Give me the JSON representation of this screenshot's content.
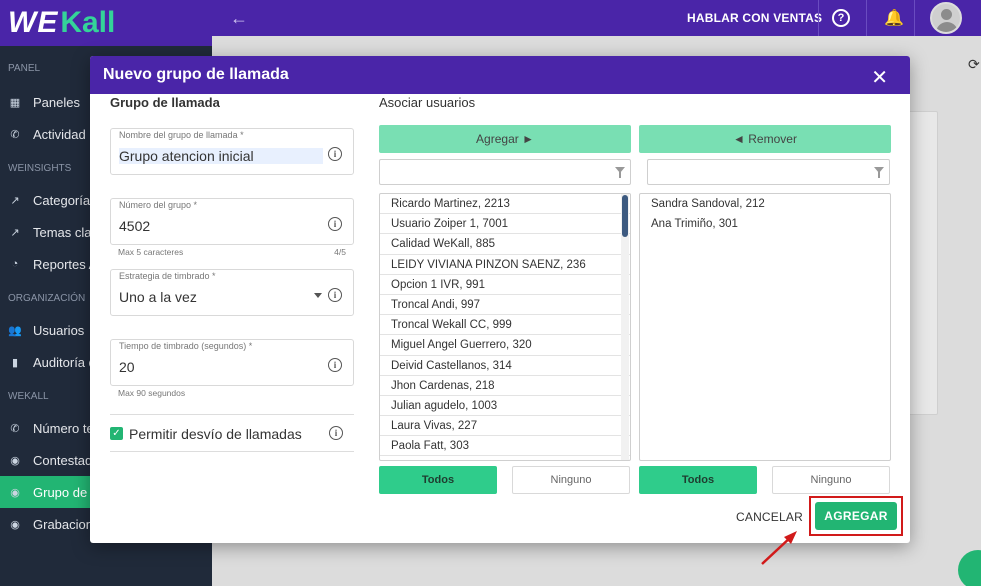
{
  "brand": {
    "we": "WE",
    "kall": "Kall"
  },
  "sidebar": {
    "sections": [
      {
        "title": "PANEL",
        "items": [
          {
            "label": "Paneles",
            "icon": "grid-icon"
          },
          {
            "label": "Actividad E",
            "icon": "phone-icon"
          }
        ]
      },
      {
        "title": "WEINSIGHTS",
        "items": [
          {
            "label": "Categorías",
            "icon": "trend-icon"
          },
          {
            "label": "Temas clav",
            "icon": "trend-icon"
          },
          {
            "label": "Reportes A",
            "icon": "chart-icon"
          }
        ]
      },
      {
        "title": "ORGANIZACIÓN",
        "items": [
          {
            "label": "Usuarios",
            "icon": "users-icon"
          },
          {
            "label": "Auditoría d",
            "icon": "audio-icon"
          }
        ]
      },
      {
        "title": "WEKALL",
        "items": [
          {
            "label": "Número tel",
            "icon": "phone-icon"
          },
          {
            "label": "Contestad",
            "icon": "palette-icon"
          },
          {
            "label": "Grupo de ll",
            "icon": "palette-icon",
            "active": true
          },
          {
            "label": "Grabaciones",
            "icon": "palette-icon"
          }
        ]
      }
    ]
  },
  "topbar": {
    "sales_label": "HABLAR CON VENTAS",
    "help": "?",
    "bell": "🔔"
  },
  "modal": {
    "title": "Nuevo grupo de llamada",
    "close": "✕",
    "left": {
      "section_title": "Grupo de llamada",
      "name_field": {
        "label": "Nombre del grupo de llamada *",
        "value": "Grupo atencion inicial"
      },
      "number_field": {
        "label": "Número del grupo *",
        "value": "4502",
        "hint": "Max 5 caracteres",
        "count": "4/5"
      },
      "strategy_field": {
        "label": "Estrategia de timbrado *",
        "value": "Uno a la vez"
      },
      "time_field": {
        "label": "Tiempo de timbrado (segundos) *",
        "value": "20",
        "hint": "Max 90 segundos"
      },
      "forward_checkbox": {
        "label": "Permitir desvío de llamadas",
        "checked": true
      }
    },
    "right": {
      "title": "Asociar usuarios",
      "add_button": "Agregar  ►",
      "remove_button": "◄   Remover",
      "available_users": [
        "Ricardo Martinez, 2213",
        "Usuario Zoiper 1, 7001",
        "Calidad WeKall, 885",
        "LEIDY VIVIANA PINZON SAENZ, 236",
        "Opcion 1 IVR, 991",
        "Troncal Andi, 997",
        "Troncal Wekall CC, 999",
        "Miguel Angel Guerrero, 320",
        "Deivid Castellanos, 314",
        "Jhon Cardenas, 218",
        "Julian agudelo, 1003",
        "Laura Vivas, 227",
        "Paola Fatt, 303"
      ],
      "selected_users": [
        "Sandra Sandoval, 212",
        "Ana Trimiño, 301"
      ],
      "all_label": "Todos",
      "none_label": "Ninguno"
    },
    "footer": {
      "cancel": "CANCELAR",
      "submit": "AGREGAR"
    }
  },
  "colors": {
    "primary": "#4a25a8",
    "accent": "#22b573",
    "highlight": "#d11a1a"
  }
}
